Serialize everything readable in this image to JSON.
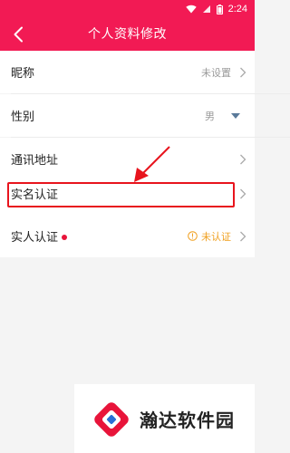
{
  "status_bar": {
    "time": "2:24"
  },
  "header": {
    "title": "个人资料修改"
  },
  "rows": [
    {
      "label": "昵称",
      "value": "未设置"
    },
    {
      "label": "性别",
      "value": "男"
    },
    {
      "label": "通讯地址"
    },
    {
      "label": "实名认证"
    },
    {
      "label": "实人认证",
      "status": "未认证"
    }
  ],
  "watermark": {
    "text": "瀚达软件园"
  },
  "colors": {
    "accent": "#f21a54",
    "highlight": "#e8141d",
    "warning": "#f0a020"
  }
}
